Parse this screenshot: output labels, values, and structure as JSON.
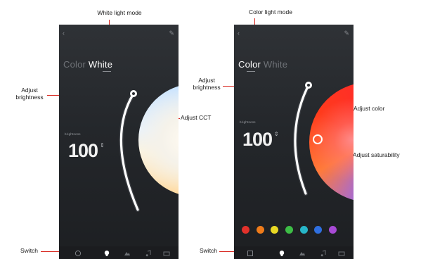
{
  "annotations": {
    "white_light_mode": "White light mode",
    "color_light_mode": "Color light mode",
    "adjust_brightness_left": [
      "Adjust",
      "brightness"
    ],
    "adjust_brightness_right": [
      "Adjust",
      "brightness"
    ],
    "adjust_cct": "Adjust CCT",
    "adjust_color": "Adjust color",
    "adjust_saturability": "Adjust saturability",
    "switch_left": "Switch",
    "switch_right": "Switch"
  },
  "phone_white": {
    "tab_color": "Color",
    "tab_white": "White",
    "active_tab": "White",
    "value_label": "brightness",
    "value": "100",
    "updown_icon": "updown-arrow-icon",
    "bottom_icons": [
      "power-icon",
      "bulb-icon",
      "scene-icon",
      "music-icon",
      "timer-icon"
    ]
  },
  "phone_color": {
    "tab_color": "Color",
    "tab_white": "White",
    "active_tab": "Color",
    "value_label": "brightness",
    "value": "100",
    "updown_icon": "updown-arrow-icon",
    "swatches": [
      "#e2312b",
      "#ef7b1a",
      "#e9d824",
      "#3dbd46",
      "#27b6c9",
      "#2f6fe0",
      "#a84ad6"
    ],
    "bottom_icons": [
      "power-icon",
      "bulb-icon",
      "scene-icon",
      "music-icon",
      "timer-icon"
    ]
  },
  "colors": {
    "annotation_line": "#d8261f",
    "phone_bg": "#24272b",
    "arc": "#ffffff"
  }
}
